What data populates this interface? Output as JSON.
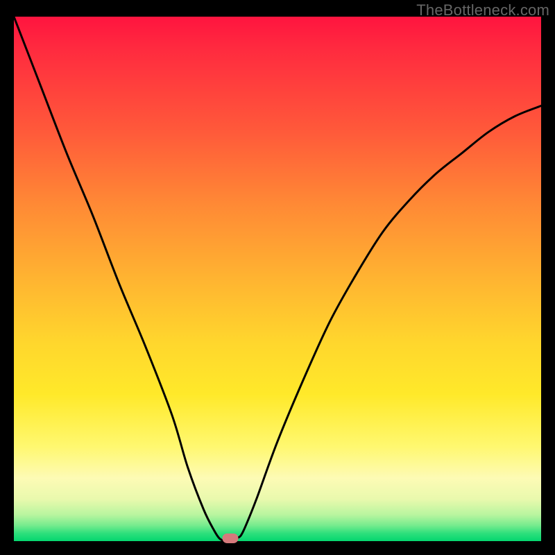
{
  "watermark": "TheBottleneck.com",
  "chart_data": {
    "type": "line",
    "title": "",
    "xlabel": "",
    "ylabel": "",
    "xlim": [
      0,
      100
    ],
    "ylim": [
      0,
      100
    ],
    "grid": false,
    "series": [
      {
        "name": "bottleneck-curve",
        "x": [
          0,
          5,
          10,
          15,
          20,
          25,
          30,
          33,
          36,
          38,
          39,
          40,
          41,
          42,
          43,
          44,
          46,
          50,
          55,
          60,
          65,
          70,
          75,
          80,
          85,
          90,
          95,
          100
        ],
        "y": [
          100,
          87,
          74,
          62,
          49,
          37,
          24,
          14,
          6,
          2,
          0.5,
          0,
          0,
          0.5,
          1,
          3,
          8,
          19,
          31,
          42,
          51,
          59,
          65,
          70,
          74,
          78,
          81,
          83
        ]
      }
    ],
    "marker": {
      "x": 41,
      "y": 0.5,
      "shape": "pill",
      "color": "#d67a7c"
    },
    "background": "rainbow-gradient-vertical",
    "frame_color": "#000000"
  }
}
